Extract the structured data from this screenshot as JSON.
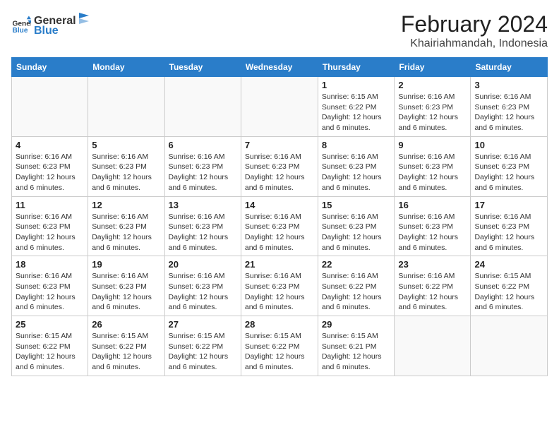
{
  "logo": {
    "line1": "General",
    "line2": "Blue"
  },
  "title": {
    "month": "February 2024",
    "location": "Khairiahmandah, Indonesia"
  },
  "headers": [
    "Sunday",
    "Monday",
    "Tuesday",
    "Wednesday",
    "Thursday",
    "Friday",
    "Saturday"
  ],
  "weeks": [
    [
      {
        "day": "",
        "info": ""
      },
      {
        "day": "",
        "info": ""
      },
      {
        "day": "",
        "info": ""
      },
      {
        "day": "",
        "info": ""
      },
      {
        "day": "1",
        "info": "Sunrise: 6:15 AM\nSunset: 6:22 PM\nDaylight: 12 hours and 6 minutes."
      },
      {
        "day": "2",
        "info": "Sunrise: 6:16 AM\nSunset: 6:23 PM\nDaylight: 12 hours and 6 minutes."
      },
      {
        "day": "3",
        "info": "Sunrise: 6:16 AM\nSunset: 6:23 PM\nDaylight: 12 hours and 6 minutes."
      }
    ],
    [
      {
        "day": "4",
        "info": "Sunrise: 6:16 AM\nSunset: 6:23 PM\nDaylight: 12 hours and 6 minutes."
      },
      {
        "day": "5",
        "info": "Sunrise: 6:16 AM\nSunset: 6:23 PM\nDaylight: 12 hours and 6 minutes."
      },
      {
        "day": "6",
        "info": "Sunrise: 6:16 AM\nSunset: 6:23 PM\nDaylight: 12 hours and 6 minutes."
      },
      {
        "day": "7",
        "info": "Sunrise: 6:16 AM\nSunset: 6:23 PM\nDaylight: 12 hours and 6 minutes."
      },
      {
        "day": "8",
        "info": "Sunrise: 6:16 AM\nSunset: 6:23 PM\nDaylight: 12 hours and 6 minutes."
      },
      {
        "day": "9",
        "info": "Sunrise: 6:16 AM\nSunset: 6:23 PM\nDaylight: 12 hours and 6 minutes."
      },
      {
        "day": "10",
        "info": "Sunrise: 6:16 AM\nSunset: 6:23 PM\nDaylight: 12 hours and 6 minutes."
      }
    ],
    [
      {
        "day": "11",
        "info": "Sunrise: 6:16 AM\nSunset: 6:23 PM\nDaylight: 12 hours and 6 minutes."
      },
      {
        "day": "12",
        "info": "Sunrise: 6:16 AM\nSunset: 6:23 PM\nDaylight: 12 hours and 6 minutes."
      },
      {
        "day": "13",
        "info": "Sunrise: 6:16 AM\nSunset: 6:23 PM\nDaylight: 12 hours and 6 minutes."
      },
      {
        "day": "14",
        "info": "Sunrise: 6:16 AM\nSunset: 6:23 PM\nDaylight: 12 hours and 6 minutes."
      },
      {
        "day": "15",
        "info": "Sunrise: 6:16 AM\nSunset: 6:23 PM\nDaylight: 12 hours and 6 minutes."
      },
      {
        "day": "16",
        "info": "Sunrise: 6:16 AM\nSunset: 6:23 PM\nDaylight: 12 hours and 6 minutes."
      },
      {
        "day": "17",
        "info": "Sunrise: 6:16 AM\nSunset: 6:23 PM\nDaylight: 12 hours and 6 minutes."
      }
    ],
    [
      {
        "day": "18",
        "info": "Sunrise: 6:16 AM\nSunset: 6:23 PM\nDaylight: 12 hours and 6 minutes."
      },
      {
        "day": "19",
        "info": "Sunrise: 6:16 AM\nSunset: 6:23 PM\nDaylight: 12 hours and 6 minutes."
      },
      {
        "day": "20",
        "info": "Sunrise: 6:16 AM\nSunset: 6:23 PM\nDaylight: 12 hours and 6 minutes."
      },
      {
        "day": "21",
        "info": "Sunrise: 6:16 AM\nSunset: 6:23 PM\nDaylight: 12 hours and 6 minutes."
      },
      {
        "day": "22",
        "info": "Sunrise: 6:16 AM\nSunset: 6:22 PM\nDaylight: 12 hours and 6 minutes."
      },
      {
        "day": "23",
        "info": "Sunrise: 6:16 AM\nSunset: 6:22 PM\nDaylight: 12 hours and 6 minutes."
      },
      {
        "day": "24",
        "info": "Sunrise: 6:15 AM\nSunset: 6:22 PM\nDaylight: 12 hours and 6 minutes."
      }
    ],
    [
      {
        "day": "25",
        "info": "Sunrise: 6:15 AM\nSunset: 6:22 PM\nDaylight: 12 hours and 6 minutes."
      },
      {
        "day": "26",
        "info": "Sunrise: 6:15 AM\nSunset: 6:22 PM\nDaylight: 12 hours and 6 minutes."
      },
      {
        "day": "27",
        "info": "Sunrise: 6:15 AM\nSunset: 6:22 PM\nDaylight: 12 hours and 6 minutes."
      },
      {
        "day": "28",
        "info": "Sunrise: 6:15 AM\nSunset: 6:22 PM\nDaylight: 12 hours and 6 minutes."
      },
      {
        "day": "29",
        "info": "Sunrise: 6:15 AM\nSunset: 6:21 PM\nDaylight: 12 hours and 6 minutes."
      },
      {
        "day": "",
        "info": ""
      },
      {
        "day": "",
        "info": ""
      }
    ]
  ]
}
